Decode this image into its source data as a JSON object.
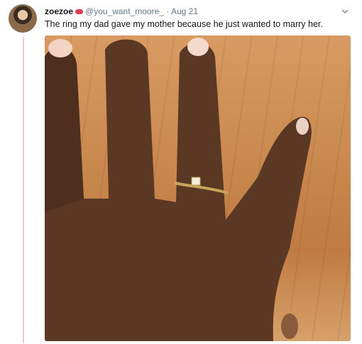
{
  "tweet": {
    "display_name": "zoezoe",
    "handle": "@you_want_moore_",
    "separator": "·",
    "date": "Aug 21",
    "text": "The ring my dad gave my mother because he just wanted to marry her."
  },
  "icons": {
    "name_emoji": "lips-emoji",
    "menu": "chevron-down-icon"
  },
  "colors": {
    "thread_line": "#f2c7d5",
    "meta_text": "#657786",
    "body_text": "#14171a"
  }
}
